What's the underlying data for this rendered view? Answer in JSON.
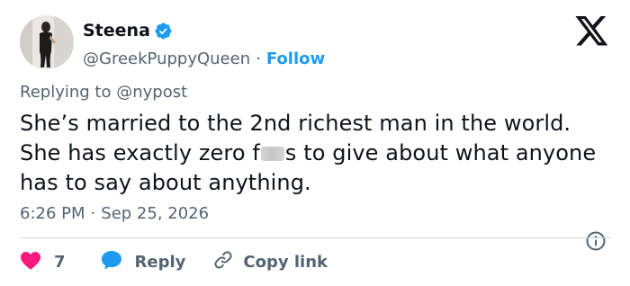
{
  "user": {
    "display_name": "Steena",
    "handle": "@GreekPuppyQueen",
    "separator": "·",
    "follow_label": "Follow"
  },
  "tweet": {
    "reply_prefix": "Replying to",
    "reply_to": "@nypost",
    "text_part1": "She’s married to the 2nd richest man in the world. She has exactly zero f",
    "text_part2": "s to give about what anyone has to say about anything.",
    "time": "6:26 PM",
    "date": "Sep 25, 2026"
  },
  "actions": {
    "like_count": "7",
    "reply_label": "Reply",
    "copy_label": "Copy link"
  },
  "icons": {
    "verified": "verified-badge-icon",
    "x_logo": "x-logo-icon",
    "info": "info-icon",
    "heart": "heart-icon",
    "reply": "reply-bubble-icon",
    "link": "link-icon"
  },
  "colors": {
    "accent": "#1d9bf0",
    "like": "#f91880",
    "muted": "#536471",
    "text": "#0f1419",
    "divider": "#cfd9de"
  }
}
